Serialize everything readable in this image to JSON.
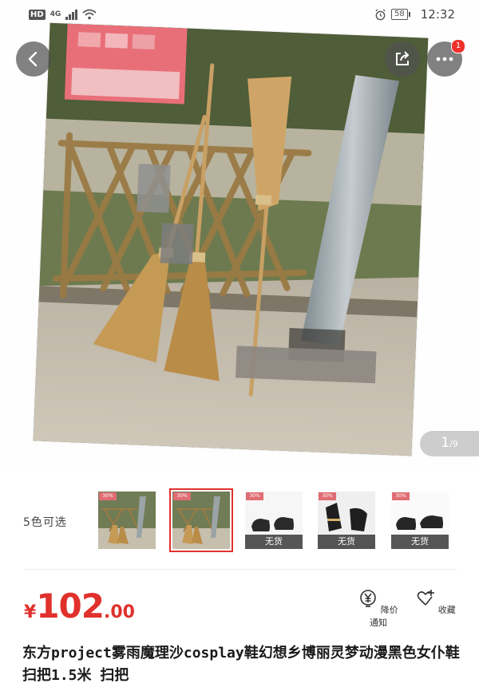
{
  "status_bar": {
    "hd": "HD",
    "network": "4G",
    "battery": "58",
    "time": "12:32"
  },
  "icons": {
    "back": "back-arrow-icon",
    "share": "share-icon",
    "more": "more-dots-icon",
    "alarm": "alarm-clock-icon",
    "wifi": "wifi-icon",
    "price_alert": "yen-bell-icon",
    "favorite": "heart-plus-icon"
  },
  "gallery": {
    "badge_count": "1",
    "current_page": "1",
    "total_pages": "/9"
  },
  "sku": {
    "label": "5色可选",
    "out_of_stock": "无货",
    "tag_text": "30%"
  },
  "price": {
    "currency": "¥",
    "integer": "102",
    "decimal": ".00"
  },
  "actions": {
    "price_alert": "降价通知",
    "favorite": "收藏"
  },
  "title": "东方project雾雨魔理沙cosplay鞋幻想乡博丽灵梦动漫黑色女仆鞋 扫把1.5米 扫把",
  "colors": {
    "accent": "#e0312c",
    "badge": "#f0302a"
  }
}
